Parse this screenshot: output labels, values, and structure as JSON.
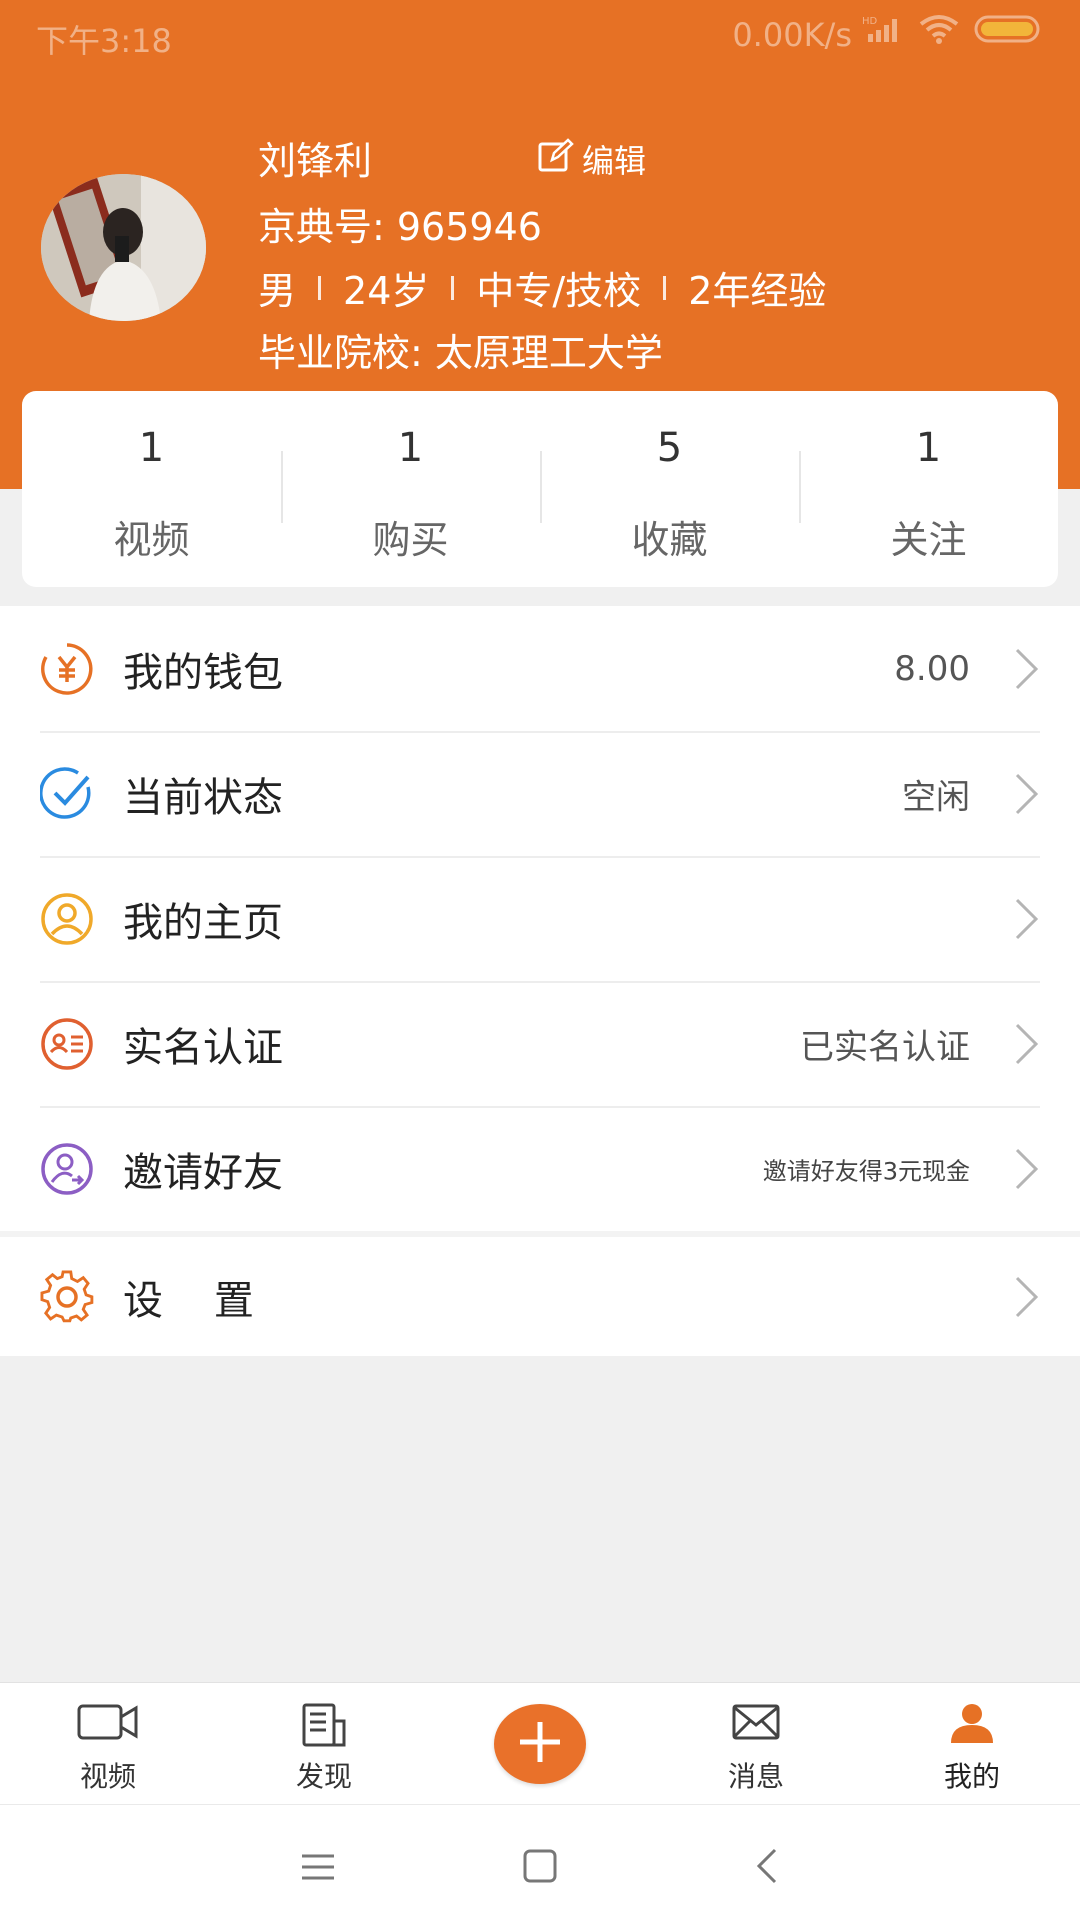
{
  "status_bar": {
    "time": "下午3:18",
    "network_speed": "0.00K/s",
    "icons": [
      "hd-signal-icon",
      "wifi-icon",
      "battery-icon"
    ]
  },
  "profile": {
    "name": "刘锋利",
    "edit_label": "编辑",
    "id_line": "京典号: 965946",
    "gender": "男",
    "age": "24岁",
    "education": "中专/技校",
    "experience": "2年经验",
    "school_line": "毕业院校: 太原理工大学"
  },
  "stats": [
    {
      "count": "1",
      "label": "视频"
    },
    {
      "count": "1",
      "label": "购买"
    },
    {
      "count": "5",
      "label": "收藏"
    },
    {
      "count": "1",
      "label": "关注"
    }
  ],
  "menu": [
    {
      "label": "我的钱包",
      "value": "8.00",
      "icon": "yuan-icon"
    },
    {
      "label": "当前状态",
      "value": "空闲",
      "icon": "check-circle-icon"
    },
    {
      "label": "我的主页",
      "value": "",
      "icon": "user-circle-icon"
    },
    {
      "label": "实名认证",
      "value": "已实名认证",
      "icon": "id-card-icon"
    },
    {
      "label": "邀请好友",
      "value": "邀请好友得3元现金",
      "icon": "invite-user-icon"
    },
    {
      "label": "设    置",
      "value": "",
      "icon": "gear-icon"
    }
  ],
  "tabs": [
    {
      "label": "视频",
      "icon": "video-camera-icon"
    },
    {
      "label": "发现",
      "icon": "document-icon"
    },
    {
      "label": "",
      "icon": "plus-icon"
    },
    {
      "label": "消息",
      "icon": "mail-icon"
    },
    {
      "label": "我的",
      "icon": "person-icon",
      "active": true
    }
  ],
  "colors": {
    "brand": "#e67125",
    "check_blue": "#2a8be0",
    "profile_yellow": "#f0a92a",
    "invite_purple": "#8c5ec4"
  }
}
